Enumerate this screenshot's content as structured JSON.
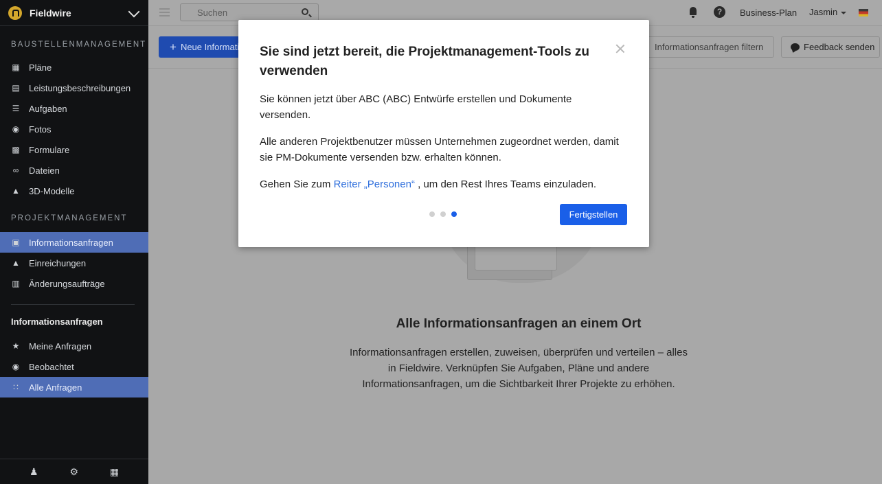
{
  "sidebar": {
    "brand": "Fieldwire",
    "section_site": "BAUSTELLENMANAGEMENT",
    "site_items": [
      {
        "label": "Pläne",
        "icon": "map-icon"
      },
      {
        "label": "Leistungsbeschreibungen",
        "icon": "notebook-icon"
      },
      {
        "label": "Aufgaben",
        "icon": "list-icon"
      },
      {
        "label": "Fotos",
        "icon": "camera-icon"
      },
      {
        "label": "Formulare",
        "icon": "clipboard-icon"
      },
      {
        "label": "Dateien",
        "icon": "paperclip-icon"
      },
      {
        "label": "3D-Modelle",
        "icon": "cube-icon"
      }
    ],
    "section_pm": "PROJEKTMANAGEMENT",
    "pm_items": [
      {
        "label": "Informationsanfragen",
        "icon": "info-doc-icon"
      },
      {
        "label": "Einreichungen",
        "icon": "stamp-icon"
      },
      {
        "label": "Änderungsaufträge",
        "icon": "change-order-icon"
      }
    ],
    "sub_title": "Informationsanfragen",
    "sub_items": [
      {
        "label": "Meine Anfragen",
        "icon": "star-icon"
      },
      {
        "label": "Beobachtet",
        "icon": "eye-icon"
      },
      {
        "label": "Alle Anfragen",
        "icon": "grid-icon"
      }
    ]
  },
  "topbar": {
    "search_placeholder": "Suchen",
    "plan": "Business-Plan",
    "user": "Jasmin"
  },
  "actions": {
    "new_label": "Neue Informationsanfrage",
    "filter_label": "Informationsanfragen filtern",
    "feedback_label": "Feedback senden"
  },
  "empty": {
    "title": "Alle Informationsanfragen an einem Ort",
    "text": "Informationsanfragen erstellen, zuweisen, überprüfen und verteilen – alles in Fieldwire. Verknüpfen Sie Aufgaben, Pläne und andere Informationsanfragen, um die Sichtbarkeit Ihrer Projekte zu erhöhen."
  },
  "modal": {
    "title": "Sie sind jetzt bereit, die Projektmanagement-Tools zu verwenden",
    "p1": "Sie können jetzt über ABC (ABC) Entwürfe erstellen und Dokumente versenden.",
    "p2": "Alle anderen Projektbenutzer müssen Unternehmen zugeordnet werden, damit sie PM-Dokumente versenden bzw. erhalten können.",
    "p3_prefix": "Gehen Sie zum ",
    "p3_link": "Reiter „Personen“",
    "p3_suffix": " , um den Rest Ihres Teams einzuladen.",
    "finish_label": "Fertigstellen",
    "step": 3,
    "steps_total": 3
  },
  "colors": {
    "accent": "#1a5fe8",
    "sidebar_active": "#4f6db6",
    "sidebar_bg": "#111214"
  }
}
